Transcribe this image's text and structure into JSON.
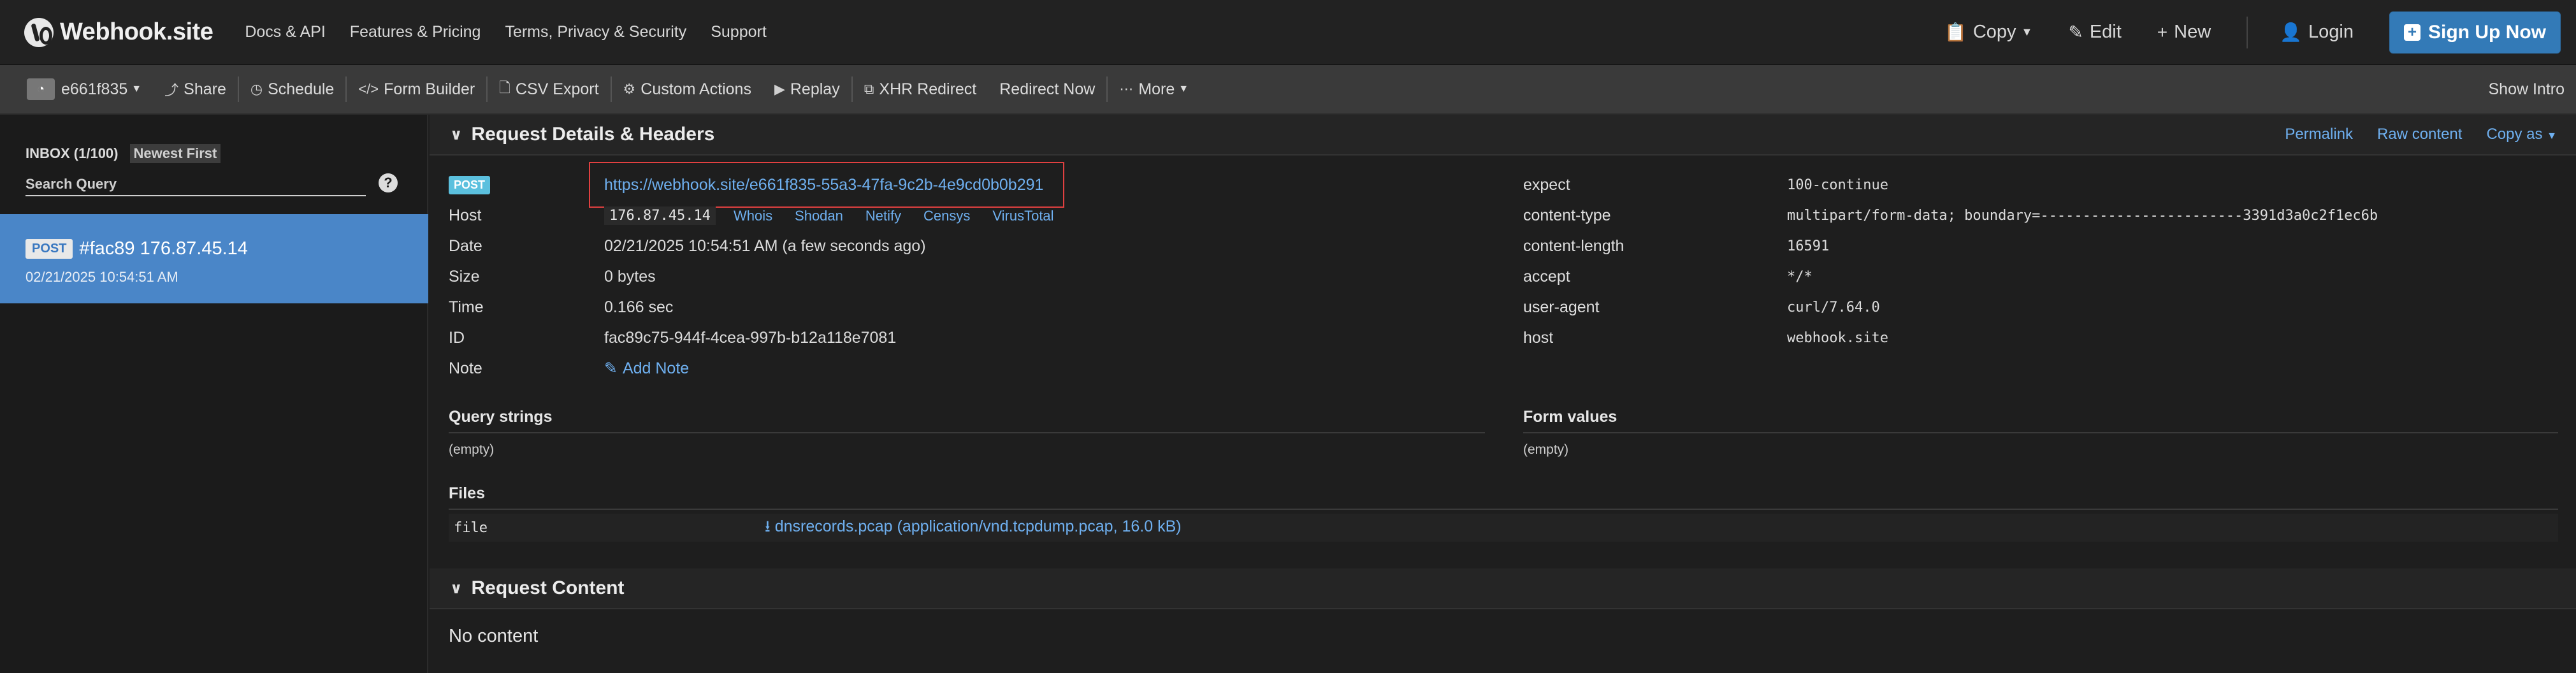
{
  "nav": {
    "brand": "Webhook.site",
    "links": [
      "Docs & API",
      "Features & Pricing",
      "Terms, Privacy & Security",
      "Support"
    ],
    "copy": "Copy",
    "edit": "Edit",
    "new": "New",
    "login": "Login",
    "signup": "Sign Up Now"
  },
  "toolbar": {
    "token": "e661f835",
    "share": "Share",
    "schedule": "Schedule",
    "form_builder": "Form Builder",
    "csv_export": "CSV Export",
    "custom_actions": "Custom Actions",
    "replay": "Replay",
    "xhr_redirect": "XHR Redirect",
    "redirect_now": "Redirect Now",
    "more": "More",
    "show_intro": "Show Intro"
  },
  "sidebar": {
    "inbox": "INBOX (1/100)",
    "sort": "Newest First",
    "search_placeholder": "Search Query",
    "help": "?",
    "request": {
      "method": "POST",
      "title": "#fac89 176.87.45.14",
      "date": "02/21/2025 10:54:51 AM"
    }
  },
  "details": {
    "title": "Request Details & Headers",
    "permalink": "Permalink",
    "raw": "Raw content",
    "copy_as": "Copy as",
    "method": "POST",
    "url": "https://webhook.site/e661f835-55a3-47fa-9c2b-4e9cd0b0b291",
    "host_label": "Host",
    "host": "176.87.45.14",
    "host_links": [
      "Whois",
      "Shodan",
      "Netify",
      "Censys",
      "VirusTotal"
    ],
    "date_label": "Date",
    "date": "02/21/2025 10:54:51 AM (a few seconds ago)",
    "size_label": "Size",
    "size": "0 bytes",
    "time_label": "Time",
    "time": "0.166 sec",
    "id_label": "ID",
    "id": "fac89c75-944f-4cea-997b-b12a118e7081",
    "note_label": "Note",
    "add_note": "Add Note",
    "headers": [
      {
        "k": "expect",
        "v": "100-continue"
      },
      {
        "k": "content-type",
        "v": "multipart/form-data; boundary=------------------------3391d3a0c2f1ec6b"
      },
      {
        "k": "content-length",
        "v": "16591"
      },
      {
        "k": "accept",
        "v": "*/*"
      },
      {
        "k": "user-agent",
        "v": "curl/7.64.0"
      },
      {
        "k": "host",
        "v": "webhook.site"
      }
    ],
    "query_strings": "Query strings",
    "query_empty": "(empty)",
    "form_values": "Form values",
    "form_empty": "(empty)",
    "files": "Files",
    "file_key": "file",
    "file_value": "dnsrecords.pcap (application/vnd.tcpdump.pcap, 16.0 kB)"
  },
  "content": {
    "title": "Request Content",
    "body": "No content"
  }
}
